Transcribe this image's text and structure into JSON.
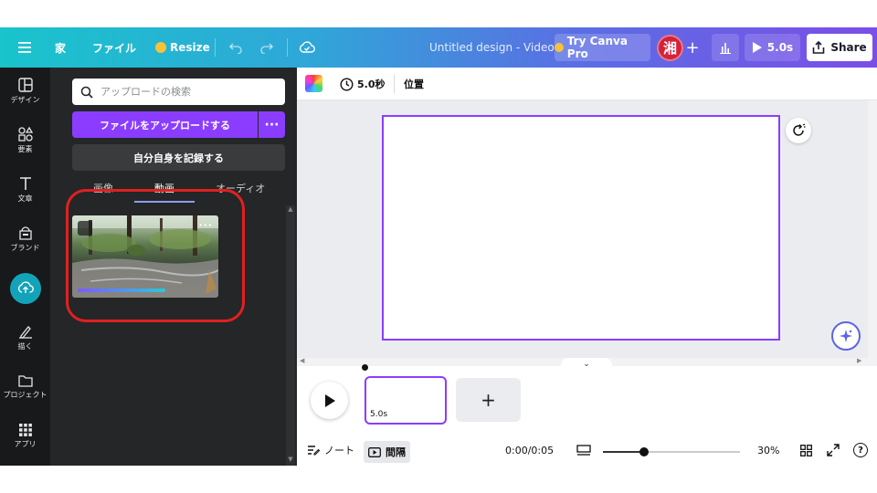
{
  "topbar": {
    "menu_icon": "hamburger-icon",
    "home_label": "家",
    "file_label": "ファイル",
    "resize_label": "Resize",
    "doc_title": "Untitled design - Video",
    "try_pro_label": "Try Canva Pro",
    "avatar_initial": "湘",
    "play_duration": "5.0s",
    "share_label": "Share"
  },
  "rail": {
    "items": [
      {
        "label": "デザイン",
        "icon": "layout-icon"
      },
      {
        "label": "要素",
        "icon": "shapes-icon"
      },
      {
        "label": "文章",
        "icon": "text-icon"
      },
      {
        "label": "ブランド",
        "icon": "brand-icon"
      },
      {
        "label": "",
        "icon": "upload-cloud-icon"
      },
      {
        "label": "描く",
        "icon": "draw-icon"
      },
      {
        "label": "プロジェクト",
        "icon": "folder-icon"
      },
      {
        "label": "アプリ",
        "icon": "apps-icon"
      }
    ]
  },
  "panel": {
    "search_placeholder": "アップロードの検索",
    "upload_label": "ファイルをアップロードする",
    "more_label": "···",
    "record_label": "自分自身を記録する",
    "tabs": [
      "画像",
      "動画",
      "オーディオ"
    ],
    "thumb_dots": "···"
  },
  "editor": {
    "duration_label": "5.0秒",
    "position_label": "位置"
  },
  "timeline": {
    "clip_label": "5.0s",
    "add_label": "+"
  },
  "bottombar": {
    "notes_label": "ノート",
    "gap_label": "間隔",
    "time_display": "0:00/0:05",
    "zoom_label": "30%",
    "help_label": "?",
    "zoom_fraction": 0.3
  },
  "colors": {
    "accent": "#8b3dff",
    "highlight": "#e02020"
  }
}
